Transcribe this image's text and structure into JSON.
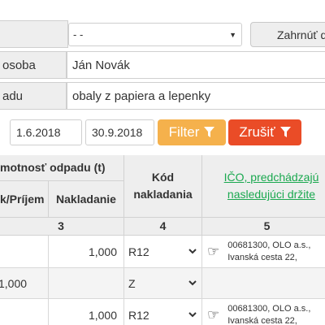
{
  "form": {
    "row1": {
      "label": "",
      "select_value": "- -",
      "button_label": "Zahrnúť d"
    },
    "row2": {
      "label": "osoba",
      "value": "Ján Novák"
    },
    "row3": {
      "label": "adu",
      "value": "obaly z papiera a lepenky"
    }
  },
  "filter": {
    "date_from": "1.6.2018",
    "date_to": "30.9.2018",
    "filter_label": "Filter",
    "cancel_label": "Zrušiť"
  },
  "table": {
    "header_group_quantity": "motnosť odpadu (t)",
    "header_receipt": "k/Príjem",
    "header_loading": "Nakladanie",
    "header_code": "Kód nakladania",
    "header_ico": "IČO, predchádzajú nasledujúci držite",
    "col_numbers": [
      "3",
      "4",
      "5"
    ],
    "rows": [
      {
        "receipt": "",
        "loading": "1,000",
        "code": "R12",
        "has_hand": true,
        "company_line1": "00681300, OLO a.s.,",
        "company_line2": "Ivanská cesta 22,"
      },
      {
        "receipt": "1,000",
        "loading": "",
        "code": "Z",
        "has_hand": false,
        "company_line1": "",
        "company_line2": ""
      },
      {
        "receipt": "",
        "loading": "1,000",
        "code": "R12",
        "has_hand": true,
        "company_line1": "00681300, OLO a.s.,",
        "company_line2": "Ivanská cesta 22,"
      }
    ]
  },
  "icons": {
    "select_caret": "caret-down-icon",
    "filter": "funnel-icon",
    "hand": "pointing-hand-icon",
    "chevron": "chevron-down-icon"
  }
}
